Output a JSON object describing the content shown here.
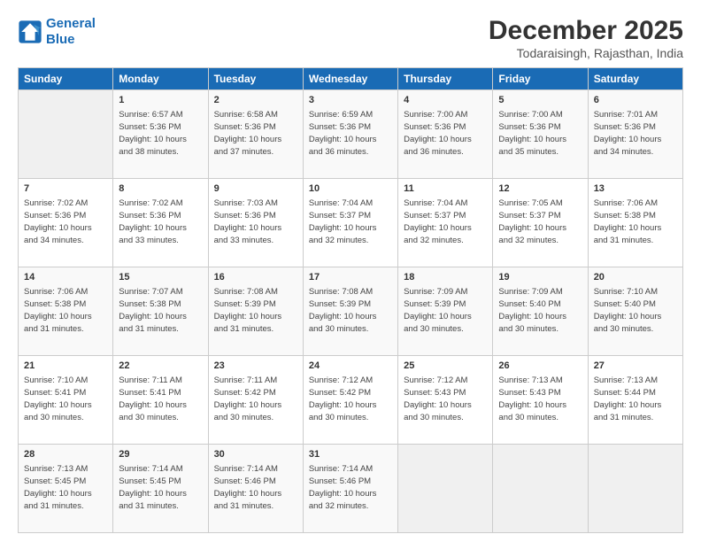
{
  "logo": {
    "line1": "General",
    "line2": "Blue"
  },
  "title": "December 2025",
  "subtitle": "Todaraisingh, Rajasthan, India",
  "days": [
    "Sunday",
    "Monday",
    "Tuesday",
    "Wednesday",
    "Thursday",
    "Friday",
    "Saturday"
  ],
  "weeks": [
    [
      {
        "date": "",
        "info": ""
      },
      {
        "date": "1",
        "info": "Sunrise: 6:57 AM\nSunset: 5:36 PM\nDaylight: 10 hours\nand 38 minutes."
      },
      {
        "date": "2",
        "info": "Sunrise: 6:58 AM\nSunset: 5:36 PM\nDaylight: 10 hours\nand 37 minutes."
      },
      {
        "date": "3",
        "info": "Sunrise: 6:59 AM\nSunset: 5:36 PM\nDaylight: 10 hours\nand 36 minutes."
      },
      {
        "date": "4",
        "info": "Sunrise: 7:00 AM\nSunset: 5:36 PM\nDaylight: 10 hours\nand 36 minutes."
      },
      {
        "date": "5",
        "info": "Sunrise: 7:00 AM\nSunset: 5:36 PM\nDaylight: 10 hours\nand 35 minutes."
      },
      {
        "date": "6",
        "info": "Sunrise: 7:01 AM\nSunset: 5:36 PM\nDaylight: 10 hours\nand 34 minutes."
      }
    ],
    [
      {
        "date": "7",
        "info": "Sunrise: 7:02 AM\nSunset: 5:36 PM\nDaylight: 10 hours\nand 34 minutes."
      },
      {
        "date": "8",
        "info": "Sunrise: 7:02 AM\nSunset: 5:36 PM\nDaylight: 10 hours\nand 33 minutes."
      },
      {
        "date": "9",
        "info": "Sunrise: 7:03 AM\nSunset: 5:36 PM\nDaylight: 10 hours\nand 33 minutes."
      },
      {
        "date": "10",
        "info": "Sunrise: 7:04 AM\nSunset: 5:37 PM\nDaylight: 10 hours\nand 32 minutes."
      },
      {
        "date": "11",
        "info": "Sunrise: 7:04 AM\nSunset: 5:37 PM\nDaylight: 10 hours\nand 32 minutes."
      },
      {
        "date": "12",
        "info": "Sunrise: 7:05 AM\nSunset: 5:37 PM\nDaylight: 10 hours\nand 32 minutes."
      },
      {
        "date": "13",
        "info": "Sunrise: 7:06 AM\nSunset: 5:38 PM\nDaylight: 10 hours\nand 31 minutes."
      }
    ],
    [
      {
        "date": "14",
        "info": "Sunrise: 7:06 AM\nSunset: 5:38 PM\nDaylight: 10 hours\nand 31 minutes."
      },
      {
        "date": "15",
        "info": "Sunrise: 7:07 AM\nSunset: 5:38 PM\nDaylight: 10 hours\nand 31 minutes."
      },
      {
        "date": "16",
        "info": "Sunrise: 7:08 AM\nSunset: 5:39 PM\nDaylight: 10 hours\nand 31 minutes."
      },
      {
        "date": "17",
        "info": "Sunrise: 7:08 AM\nSunset: 5:39 PM\nDaylight: 10 hours\nand 30 minutes."
      },
      {
        "date": "18",
        "info": "Sunrise: 7:09 AM\nSunset: 5:39 PM\nDaylight: 10 hours\nand 30 minutes."
      },
      {
        "date": "19",
        "info": "Sunrise: 7:09 AM\nSunset: 5:40 PM\nDaylight: 10 hours\nand 30 minutes."
      },
      {
        "date": "20",
        "info": "Sunrise: 7:10 AM\nSunset: 5:40 PM\nDaylight: 10 hours\nand 30 minutes."
      }
    ],
    [
      {
        "date": "21",
        "info": "Sunrise: 7:10 AM\nSunset: 5:41 PM\nDaylight: 10 hours\nand 30 minutes."
      },
      {
        "date": "22",
        "info": "Sunrise: 7:11 AM\nSunset: 5:41 PM\nDaylight: 10 hours\nand 30 minutes."
      },
      {
        "date": "23",
        "info": "Sunrise: 7:11 AM\nSunset: 5:42 PM\nDaylight: 10 hours\nand 30 minutes."
      },
      {
        "date": "24",
        "info": "Sunrise: 7:12 AM\nSunset: 5:42 PM\nDaylight: 10 hours\nand 30 minutes."
      },
      {
        "date": "25",
        "info": "Sunrise: 7:12 AM\nSunset: 5:43 PM\nDaylight: 10 hours\nand 30 minutes."
      },
      {
        "date": "26",
        "info": "Sunrise: 7:13 AM\nSunset: 5:43 PM\nDaylight: 10 hours\nand 30 minutes."
      },
      {
        "date": "27",
        "info": "Sunrise: 7:13 AM\nSunset: 5:44 PM\nDaylight: 10 hours\nand 31 minutes."
      }
    ],
    [
      {
        "date": "28",
        "info": "Sunrise: 7:13 AM\nSunset: 5:45 PM\nDaylight: 10 hours\nand 31 minutes."
      },
      {
        "date": "29",
        "info": "Sunrise: 7:14 AM\nSunset: 5:45 PM\nDaylight: 10 hours\nand 31 minutes."
      },
      {
        "date": "30",
        "info": "Sunrise: 7:14 AM\nSunset: 5:46 PM\nDaylight: 10 hours\nand 31 minutes."
      },
      {
        "date": "31",
        "info": "Sunrise: 7:14 AM\nSunset: 5:46 PM\nDaylight: 10 hours\nand 32 minutes."
      },
      {
        "date": "",
        "info": ""
      },
      {
        "date": "",
        "info": ""
      },
      {
        "date": "",
        "info": ""
      }
    ]
  ]
}
